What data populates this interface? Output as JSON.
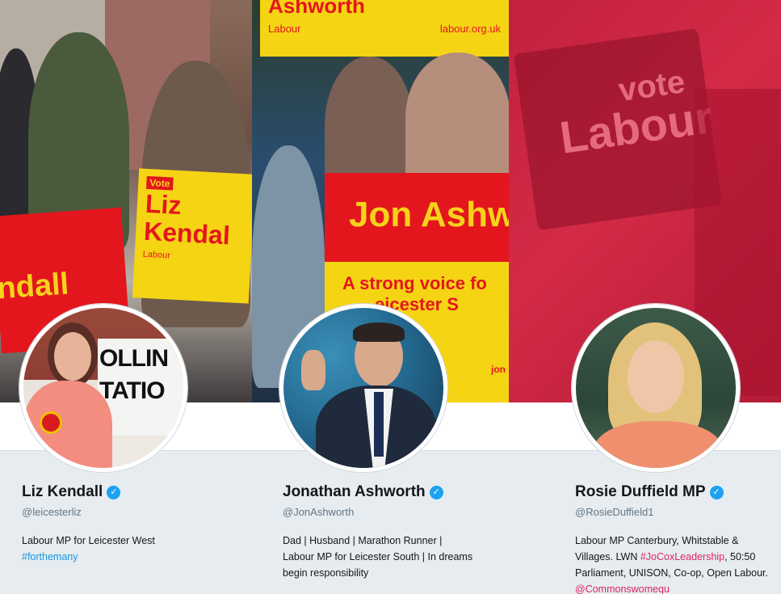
{
  "banners": [
    {
      "sign_vote": "Vote",
      "sign_name_line1": "Liz",
      "sign_name_line2": "Kendal",
      "sign_party": "Labour",
      "sign_left_text": "ndall"
    },
    {
      "top_sign_party": "Labour",
      "top_sign_url": "labour.org.uk",
      "top_sign_name": "Ashworth",
      "main_sign_name": "Jon Ashw",
      "main_sign_slogan_1": "A strong voice fo",
      "main_sign_slogan_2": "eicester S",
      "main_sign_tail": "jon"
    },
    {
      "blur_text_1": "vote",
      "blur_text_2": "Labour"
    }
  ],
  "avatar_texts": {
    "polling_1": "OLLIN",
    "polling_2": "TATIO"
  },
  "profiles": [
    {
      "name": "Liz Kendall",
      "handle": "@leicesterliz",
      "bio_text": "Labour MP for Leicester West",
      "bio_link": "#forthemany"
    },
    {
      "name": "Jonathan Ashworth",
      "handle": "@JonAshworth",
      "bio_line_1": "Dad | Husband | Marathon Runner |",
      "bio_line_2": "Labour MP for Leicester South | In dreams",
      "bio_line_3": "begin responsibility"
    },
    {
      "name": "Rosie Duffield MP",
      "handle": "@RosieDuffield1",
      "bio_part_1": "Labour MP Canterbury, Whitstable & Villages. LWN ",
      "bio_link_1": "#JoCoxLeadership",
      "bio_part_2": ", 50:50 Parliament, UNISON, Co-op, Open Labour. ",
      "bio_link_2": "@Commonswomequ"
    }
  ],
  "icons": {
    "verified": "verified-badge-icon"
  },
  "colors": {
    "verified": "#1da1f2",
    "hashtag_link": "#1b95e0",
    "red_link": "#e0245e",
    "labour_red": "#e4161d",
    "labour_yellow": "#f5d414"
  }
}
